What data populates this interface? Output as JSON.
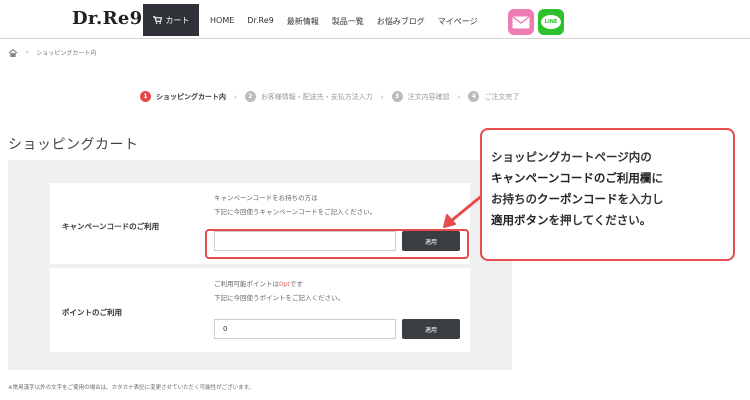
{
  "header": {
    "logo": "Dr.Re9",
    "cart_label": "カート",
    "nav": [
      "HOME",
      "Dr.Re9",
      "最新情報",
      "製品一覧",
      "お悩みブログ",
      "マイページ"
    ],
    "line_label": "LINE"
  },
  "breadcrumb": {
    "current": "ショッピングカート内"
  },
  "steps": [
    {
      "num": "1",
      "label": "ショッピングカート内",
      "active": true
    },
    {
      "num": "2",
      "label": "お客様情報・配送先・支払方法入力",
      "active": false
    },
    {
      "num": "3",
      "label": "注文内容確認",
      "active": false
    },
    {
      "num": "4",
      "label": "ご注文完了",
      "active": false
    }
  ],
  "step_separator": "›",
  "page_title": "ショッピングカート",
  "campaign": {
    "label": "キャンペーンコードのご利用",
    "desc1": "キャンペーンコードをお持ちの方は",
    "desc2": "下記に今回使うキャンペーンコードをご記入ください。",
    "input_value": "",
    "apply_label": "適用"
  },
  "points": {
    "label": "ポイントのご利用",
    "desc1_prefix": "ご利用可能ポイントは",
    "desc1_points": "0pt",
    "desc1_suffix": "です",
    "desc2": "下記に今回使うポイントをご記入ください。",
    "input_value": "0",
    "apply_label": "適用"
  },
  "callout": {
    "l1": "ショッピングカートページ内の",
    "l2a": "キャンペーンコードのご利用欄",
    "l2b": "に",
    "l3a": "お持ちの",
    "l3b": "クーポンコード",
    "l3c": "を入力し",
    "l4a": "適用ボタン",
    "l4b": "を押してください。"
  },
  "footnote": "※常用漢字以外の文字をご使用の場合は、カタカナ表記に変更させていただく可能性がございます。",
  "colors": {
    "accent_red": "#e74c4c",
    "dark_button": "#3a3d42",
    "mail_pink": "#ee7bb4",
    "line_green": "#2dc12d"
  }
}
